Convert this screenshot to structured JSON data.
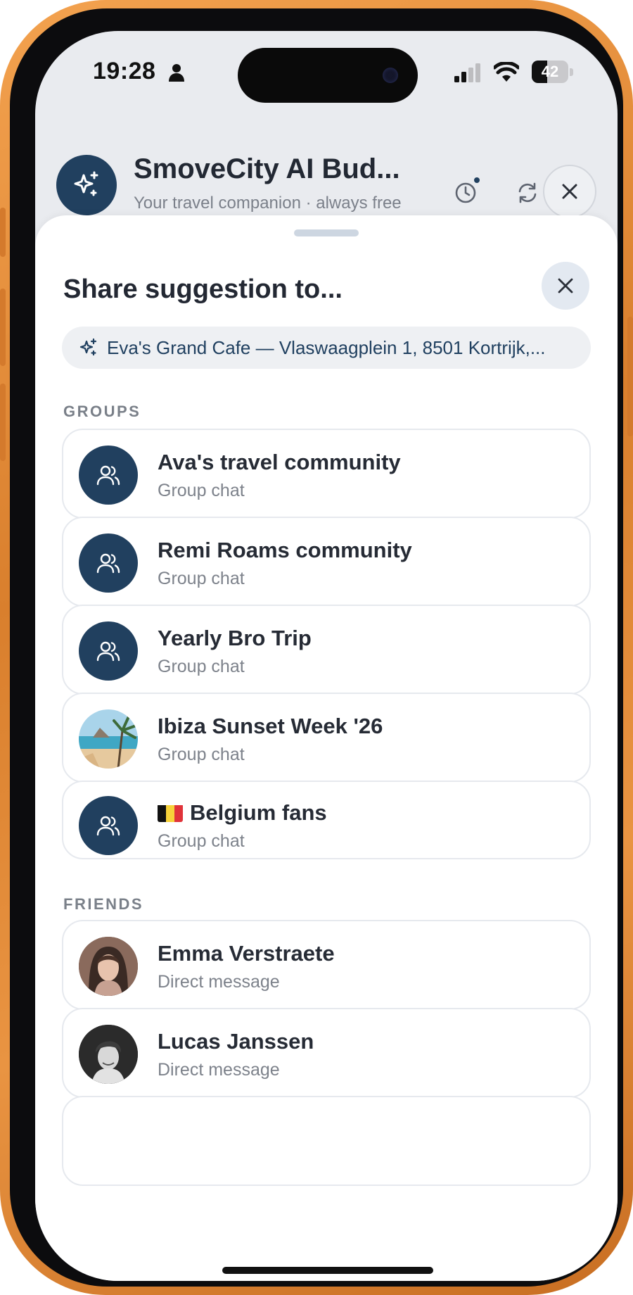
{
  "status_bar": {
    "time": "19:28",
    "battery": "42",
    "battery_level": 0.42
  },
  "header": {
    "title": "SmoveCity AI Bud...",
    "subtitle": "Your travel companion · always free",
    "icons": [
      "sparkles-icon",
      "history-icon",
      "refresh-icon",
      "close-icon"
    ]
  },
  "sheet": {
    "title": "Share suggestion to...",
    "suggestion": "Eva's Grand Cafe — Vlaswaagplein 1, 8501 Kortrijk,...",
    "groups_label": "GROUPS",
    "groups": [
      {
        "name": "Ava's travel community",
        "type": "Group chat",
        "avatar": "group-icon"
      },
      {
        "name": "Remi Roams community",
        "type": "Group chat",
        "avatar": "group-icon"
      },
      {
        "name": "Yearly Bro Trip",
        "type": "Group chat",
        "avatar": "group-icon"
      },
      {
        "name": "Ibiza Sunset Week '26",
        "type": "Group chat",
        "avatar": "photo"
      },
      {
        "name": "Belgium fans",
        "type": "Group chat",
        "avatar": "group-icon",
        "flag": "belgium-flag"
      }
    ],
    "friends_label": "FRIENDS",
    "friends": [
      {
        "name": "Emma Verstraete",
        "type": "Direct message",
        "avatar": "photo"
      },
      {
        "name": "Lucas Janssen",
        "type": "Direct message",
        "avatar": "photo"
      }
    ]
  },
  "colors": {
    "primary": "#21405f",
    "frame": "#e08a37",
    "card_border": "#e6e9ee",
    "muted_text": "#7d828b"
  }
}
